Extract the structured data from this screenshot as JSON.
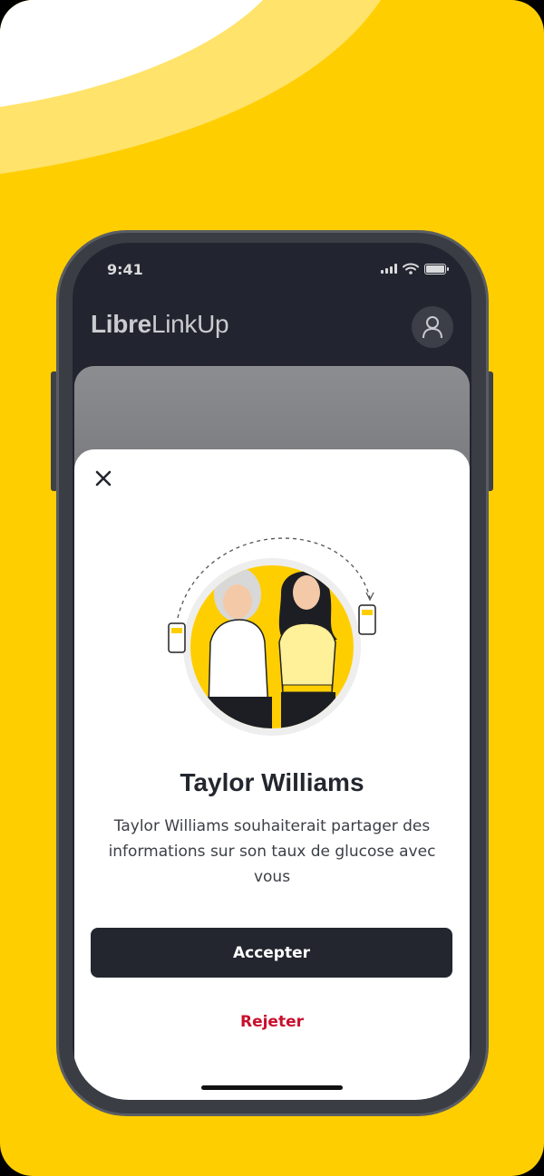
{
  "status_bar": {
    "time": "9:41"
  },
  "header": {
    "app_name_bold": "Libre",
    "app_name_light": "LinkUp"
  },
  "invite": {
    "contact_name": "Taylor Williams",
    "message": "Taylor Williams souhaiterait partager des informations sur son taux de glucose avec vous",
    "accept_label": "Accepter",
    "reject_label": "Rejeter"
  },
  "icons": {
    "close": "close-icon",
    "profile": "person-icon",
    "signal": "signal-icon",
    "wifi": "wifi-icon",
    "battery": "battery-icon"
  },
  "colors": {
    "background": "#FFCE00",
    "screen": "#22252F",
    "primary_button": "#23262F",
    "reject_text": "#C8102E"
  }
}
